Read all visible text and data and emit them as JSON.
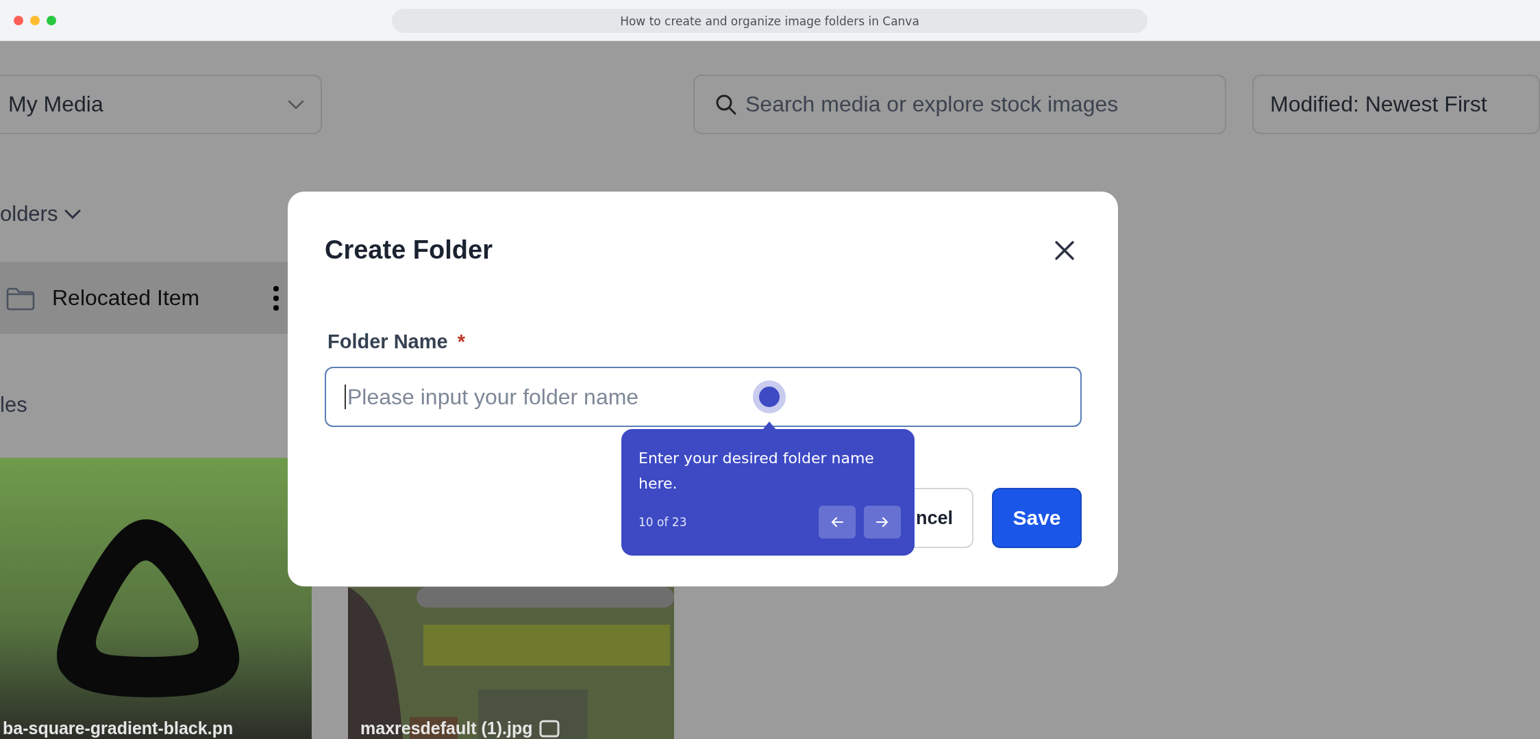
{
  "window": {
    "title": "How to create and organize image folders in Canva"
  },
  "toolbar": {
    "media_dropdown": "My Media",
    "search": {
      "placeholder": "Search media or explore stock images"
    },
    "sort": "Modified: Newest First"
  },
  "sidebar": {
    "folders_heading": "olders",
    "folders": [
      {
        "name": "Relocated Item",
        "selected": true
      }
    ],
    "files_heading": "les"
  },
  "files": [
    {
      "kind": "picture",
      "caption": "ba-square-gradient-black.pn"
    },
    {
      "kind": "picture",
      "caption": "maxresdefault (1).jpg"
    }
  ],
  "dialog": {
    "title": "Create Folder",
    "field_label": "Folder Name",
    "required_mark": "*",
    "field": {
      "placeholder": "Please input your folder name"
    },
    "buttons": [
      {
        "label": "ncel",
        "kind": "secondary"
      },
      {
        "label": "Save",
        "kind": "primary"
      }
    ]
  },
  "tooltip": {
    "text": "Enter your desired folder name here.",
    "step": "10 of 23"
  }
}
